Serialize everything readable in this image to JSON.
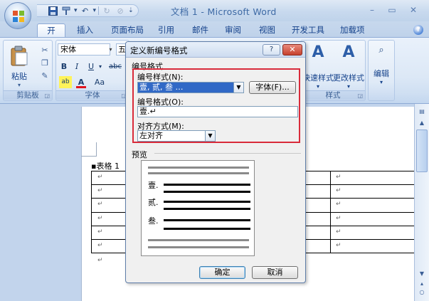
{
  "window": {
    "title": "文档 1 - Microsoft Word",
    "minimize": "–",
    "maximize": "▭",
    "close": "✕"
  },
  "quick_access": {
    "save_icon": "save-icon",
    "undo_icon": "undo-icon",
    "redo_icon": "redo-icon"
  },
  "tabs": [
    {
      "label": "开始",
      "active": true
    },
    {
      "label": "插入",
      "active": false
    },
    {
      "label": "页面布局",
      "active": false
    },
    {
      "label": "引用",
      "active": false
    },
    {
      "label": "邮件",
      "active": false
    },
    {
      "label": "审阅",
      "active": false
    },
    {
      "label": "视图",
      "active": false
    },
    {
      "label": "开发工具",
      "active": false
    },
    {
      "label": "加载项",
      "active": false
    }
  ],
  "ribbon": {
    "clipboard": {
      "paste_label": "粘贴",
      "group_label": "剪贴板"
    },
    "font": {
      "font_name": "宋体",
      "font_size": "五",
      "group_label": "字体",
      "bold": "B",
      "italic": "I",
      "underline": "U",
      "strike": "abc",
      "font_color": "A",
      "change_case": "Aa"
    },
    "styles": {
      "quick_styles_label": "快速样式",
      "change_styles_label": "更改样式",
      "group_label": "样式"
    },
    "editing": {
      "edit_label": "编辑"
    }
  },
  "document": {
    "caption": "▪表格 1",
    "paragraph_mark": "↵"
  },
  "dialog": {
    "title": "定义新编号格式",
    "help_button": "?",
    "close_button": "✕",
    "section_label": "编号格式",
    "number_style_label": "编号样式(N):",
    "number_style_value": "壹, 贰, 叁 …",
    "font_button": "字体(F)...",
    "number_format_label": "编号格式(O):",
    "number_format_value": "壹.↵",
    "alignment_label": "对齐方式(M):",
    "alignment_value": "左对齐",
    "preview_label": "预览",
    "preview_numbers": [
      "壹.",
      "贰.",
      "叁."
    ],
    "ok_button": "确定",
    "cancel_button": "取消"
  },
  "colors": {
    "highlight_frame": "#d92b3a",
    "selection": "#3169c6",
    "ribbon_text": "#15428b"
  }
}
